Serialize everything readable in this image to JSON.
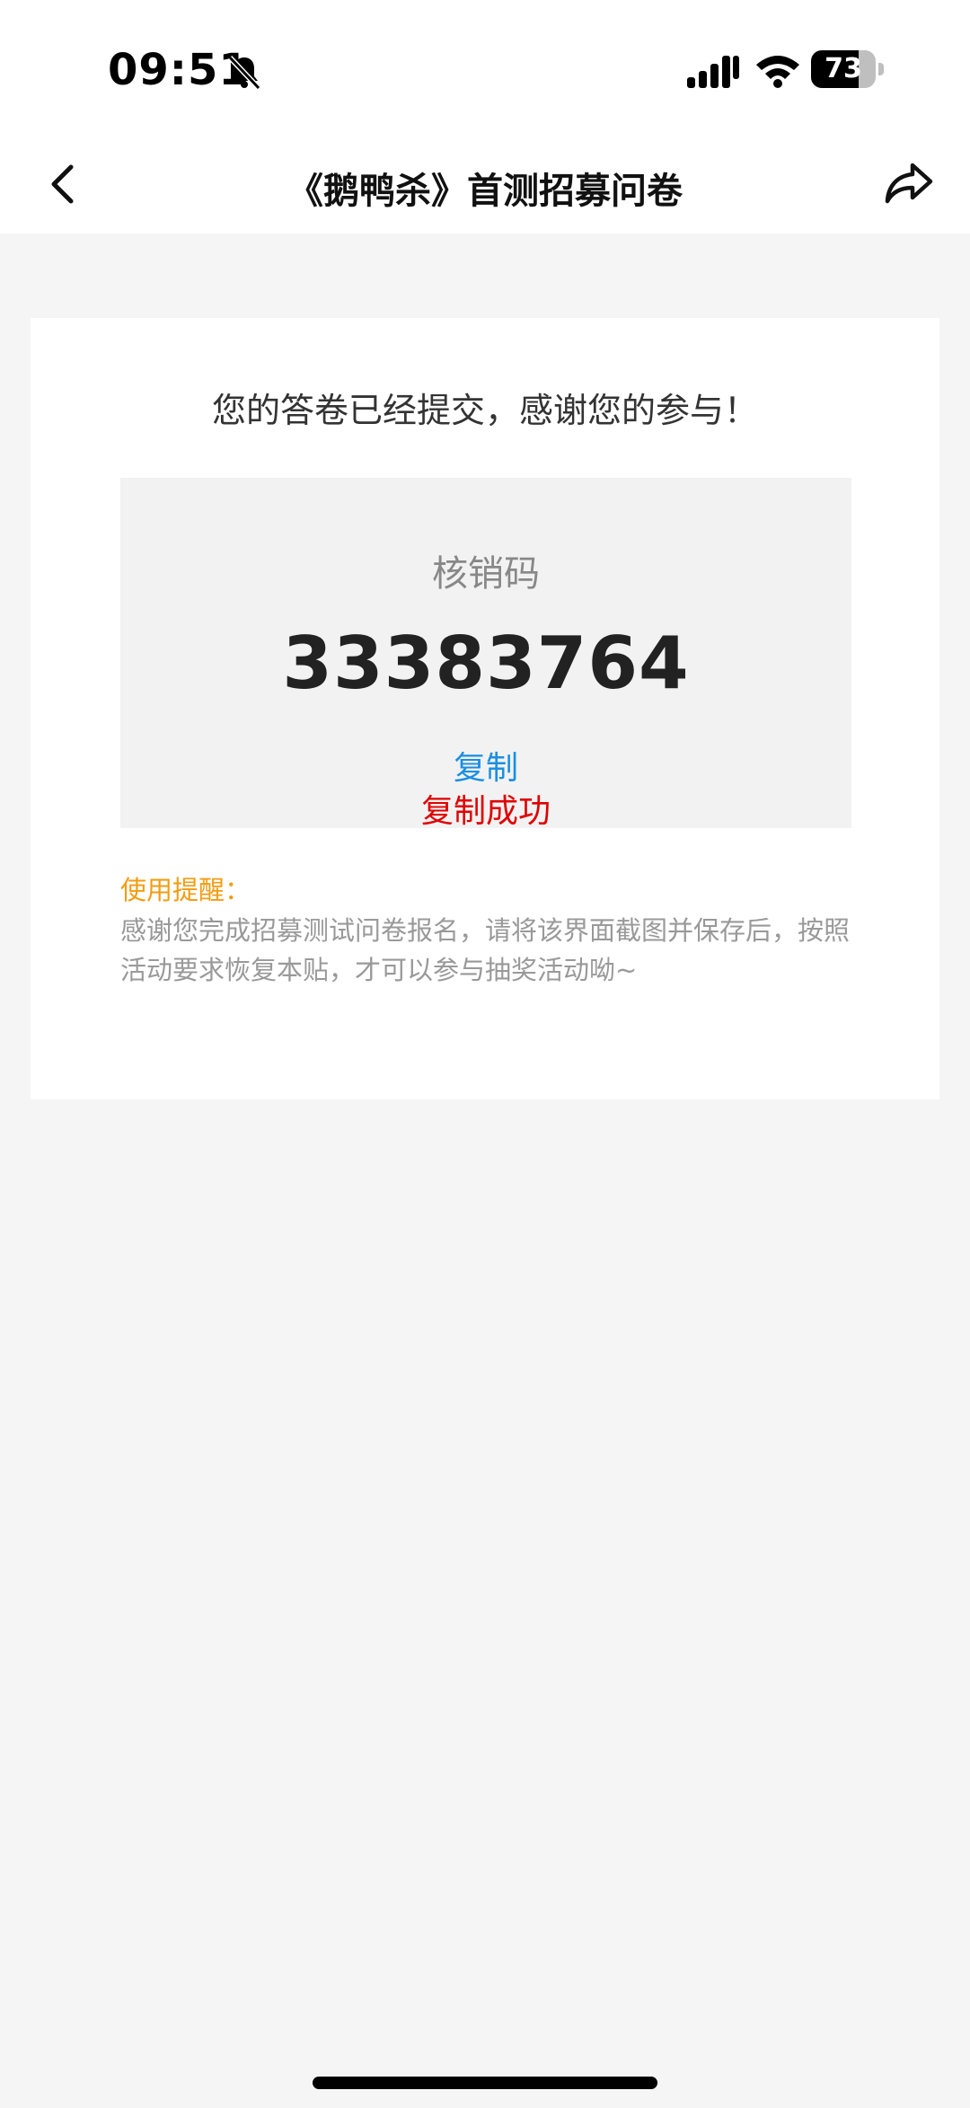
{
  "status_bar": {
    "time": "09:51",
    "battery_percent": 73,
    "battery_text": "73"
  },
  "nav": {
    "title": "《鹅鸭杀》首测招募问卷"
  },
  "card": {
    "thanks_text": "您的答卷已经提交，感谢您的参与！",
    "code_label": "核销码",
    "code_value": "33383764",
    "copy_label": "复制",
    "copy_success": "复制成功",
    "reminder_title": "使用提醒：",
    "reminder_text": "感谢您完成招募测试问卷报名，请将该界面截图并保存后，按照活动要求恢复本贴，才可以参与抽奖活动呦~"
  },
  "colors": {
    "accent_blue": "#1a8fe3",
    "success_red": "#e00000",
    "reminder_orange": "#f39c12"
  },
  "icons": {
    "back": "chevron-left-icon",
    "share": "share-arrow-icon",
    "bell": "bell-slash-icon",
    "signal": "signal-icon",
    "wifi": "wifi-icon"
  }
}
